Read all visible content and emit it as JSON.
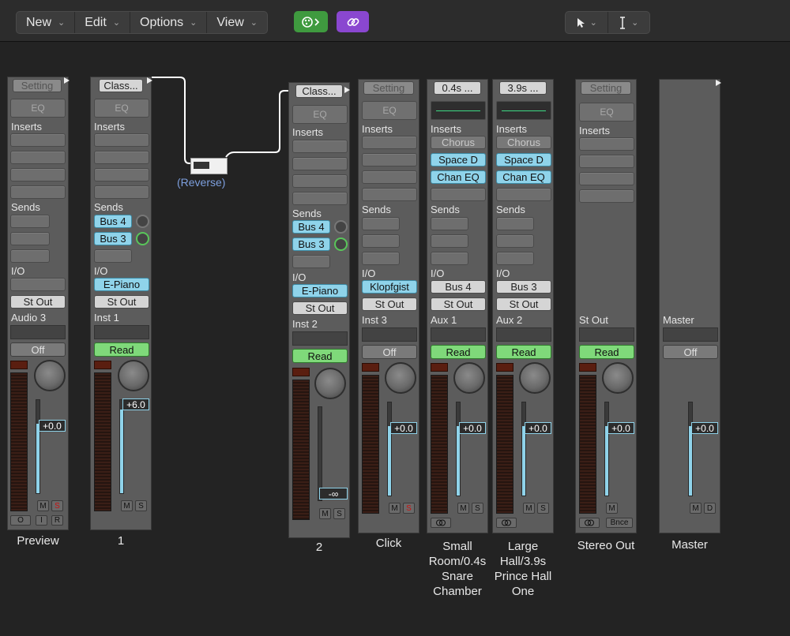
{
  "toolbar": {
    "menus": [
      {
        "label": "New"
      },
      {
        "label": "Edit"
      },
      {
        "label": "Options"
      },
      {
        "label": "View"
      }
    ],
    "chevron": "⌄",
    "tool_chevron": "⌄"
  },
  "routing": {
    "reverse_label": "(Reverse)"
  },
  "strips": [
    {
      "id": "preview",
      "name": "Preview",
      "setting": "Setting",
      "eq": "EQ",
      "inserts_label": "Inserts",
      "sends_label": "Sends",
      "io_label": "I/O",
      "output": "St Out",
      "track_name": "Audio 3",
      "automation": "Off",
      "fader_value": "+0.0",
      "fader_level": 0.75,
      "buttons": [
        "M",
        "S"
      ],
      "extra": [
        "O",
        "I",
        "R"
      ]
    },
    {
      "id": "inst1",
      "name": "1",
      "setting": "Class...",
      "eq": "EQ",
      "inserts_label": "Inserts",
      "sends_label": "Sends",
      "io_label": "I/O",
      "sends": [
        "Bus 4",
        "Bus 3"
      ],
      "input": "E-Piano",
      "output": "St Out",
      "track_name": "Inst 1",
      "automation": "Read",
      "fader_value": "+6.0",
      "fader_level": 0.9,
      "buttons": [
        "M",
        "S"
      ]
    },
    {
      "id": "inst2",
      "name": "2",
      "setting": "Class...",
      "eq": "EQ",
      "inserts_label": "Inserts",
      "sends_label": "Sends",
      "io_label": "I/O",
      "sends": [
        "Bus 4",
        "Bus 3"
      ],
      "input": "E-Piano",
      "output": "St Out",
      "track_name": "Inst 2",
      "automation": "Read",
      "fader_value": "-∞",
      "fader_level": 0.0,
      "buttons": [
        "M",
        "S"
      ]
    },
    {
      "id": "click",
      "name": "Click",
      "setting": "Setting",
      "eq": "EQ",
      "inserts_label": "Inserts",
      "sends_label": "Sends",
      "io_label": "I/O",
      "input": "Klopfgist",
      "output": "St Out",
      "track_name": "Inst 3",
      "automation": "Off",
      "fader_value": "+0.0",
      "fader_level": 0.75,
      "buttons": [
        "M",
        "S"
      ]
    },
    {
      "id": "aux1",
      "name": "Small Room/0.4s Snare Chamber",
      "setting": "0.4s ...",
      "inserts_label": "Inserts",
      "sends_label": "Sends",
      "io_label": "I/O",
      "inserts": [
        "Chorus",
        "Space D",
        "Chan EQ"
      ],
      "input": "Bus 4",
      "output": "St Out",
      "track_name": "Aux 1",
      "automation": "Read",
      "fader_value": "+0.0",
      "fader_level": 0.75,
      "buttons": [
        "M",
        "S"
      ]
    },
    {
      "id": "aux2",
      "name": "Large Hall/3.9s Prince Hall One",
      "setting": "3.9s ...",
      "inserts_label": "Inserts",
      "sends_label": "Sends",
      "io_label": "I/O",
      "inserts": [
        "Chorus",
        "Space D",
        "Chan EQ"
      ],
      "input": "Bus 3",
      "output": "St Out",
      "track_name": "Aux 2",
      "automation": "Read",
      "fader_value": "+0.0",
      "fader_level": 0.75,
      "buttons": [
        "M",
        "S"
      ]
    },
    {
      "id": "stereo-out",
      "name": "Stereo Out",
      "setting": "Setting",
      "eq": "EQ",
      "inserts_label": "Inserts",
      "track_name": "St Out",
      "automation": "Read",
      "fader_value": "+0.0",
      "fader_level": 0.75,
      "buttons": [
        "M"
      ],
      "bounce": "Bnce"
    },
    {
      "id": "master",
      "name": "Master",
      "track_name": "Master",
      "automation": "Off",
      "fader_value": "+0.0",
      "fader_level": 0.75,
      "buttons": [
        "M",
        "D"
      ]
    }
  ],
  "colors": {
    "accent_blue": "#8fd3ea",
    "read_green": "#7fd97a",
    "plugin_green": "#3f9a3f",
    "link_purple": "#8a47d0",
    "routing_label": "#7d9fde"
  }
}
